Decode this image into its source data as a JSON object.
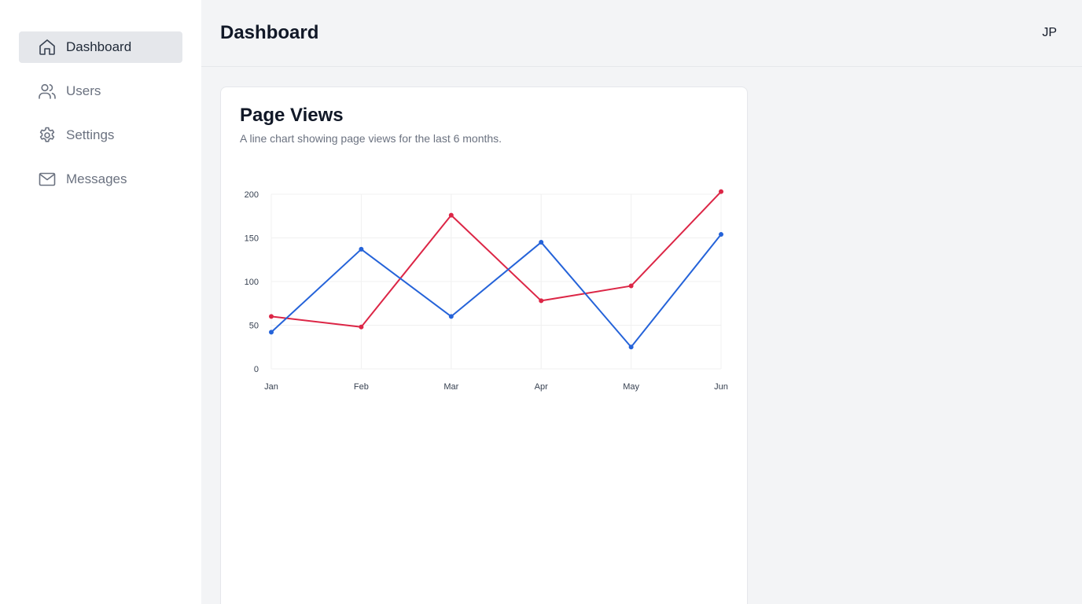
{
  "sidebar": {
    "items": [
      {
        "label": "Dashboard",
        "icon": "home-icon",
        "active": true
      },
      {
        "label": "Users",
        "icon": "users-icon",
        "active": false
      },
      {
        "label": "Settings",
        "icon": "gear-icon",
        "active": false
      },
      {
        "label": "Messages",
        "icon": "mail-icon",
        "active": false
      }
    ]
  },
  "header": {
    "title": "Dashboard",
    "avatar_initials": "JP"
  },
  "card": {
    "title": "Page Views",
    "description": "A line chart showing page views for the last 6 months."
  },
  "colors": {
    "series_red": "#dc2646",
    "series_blue": "#2563d9",
    "grid": "#f0f0f0"
  },
  "chart_data": {
    "type": "line",
    "categories": [
      "Jan",
      "Feb",
      "Mar",
      "Apr",
      "May",
      "Jun"
    ],
    "series": [
      {
        "values": [
          60,
          48,
          176,
          78,
          95,
          203
        ],
        "color": "#dc2646"
      },
      {
        "values": [
          42,
          137,
          60,
          145,
          25,
          154
        ],
        "color": "#2563d9"
      }
    ],
    "ylim": [
      0,
      200
    ],
    "yticks": [
      0,
      50,
      100,
      150,
      200
    ],
    "grid": true,
    "title": "",
    "xlabel": "",
    "ylabel": ""
  }
}
